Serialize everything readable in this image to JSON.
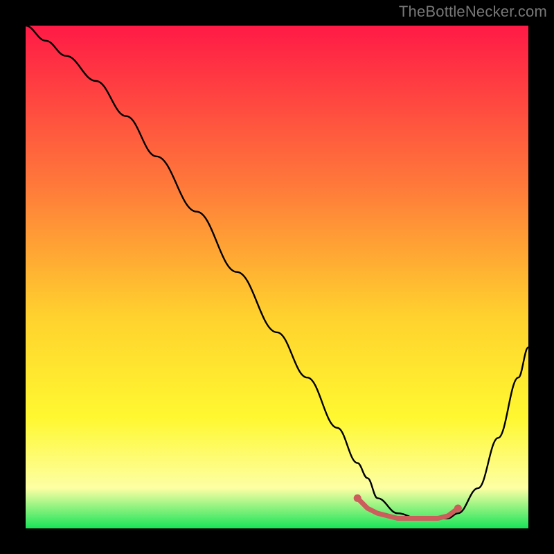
{
  "attribution": "TheBottleNecker.com",
  "colors": {
    "gradient_top": "#ff1a46",
    "gradient_mid1": "#ff7a3a",
    "gradient_mid2": "#ffd22e",
    "gradient_mid3": "#fff830",
    "gradient_mid4": "#fdffa4",
    "gradient_bottom": "#18e458",
    "curve": "#000000",
    "marker": "#cd5c5c",
    "background": "#000000"
  },
  "chart_data": {
    "type": "line",
    "title": "",
    "xlabel": "",
    "ylabel": "",
    "xlim": [
      0,
      100
    ],
    "ylim": [
      0,
      100
    ],
    "grid": false,
    "legend": false,
    "series": [
      {
        "name": "bottleneck-curve",
        "x": [
          0,
          4,
          8,
          14,
          20,
          26,
          34,
          42,
          50,
          56,
          62,
          66,
          68,
          70,
          74,
          78,
          82,
          84,
          86,
          90,
          94,
          98,
          100
        ],
        "y": [
          100,
          97,
          94,
          89,
          82,
          74,
          63,
          51,
          39,
          30,
          20,
          13,
          10,
          6,
          3,
          2,
          2,
          2,
          3,
          8,
          18,
          30,
          36
        ]
      }
    ],
    "markers": {
      "name": "trough-connector",
      "x": [
        66,
        68,
        70,
        72,
        74,
        76,
        78,
        80,
        82,
        84,
        86
      ],
      "y": [
        6,
        4,
        3,
        2.5,
        2,
        2,
        2,
        2,
        2,
        2.5,
        4
      ]
    }
  }
}
